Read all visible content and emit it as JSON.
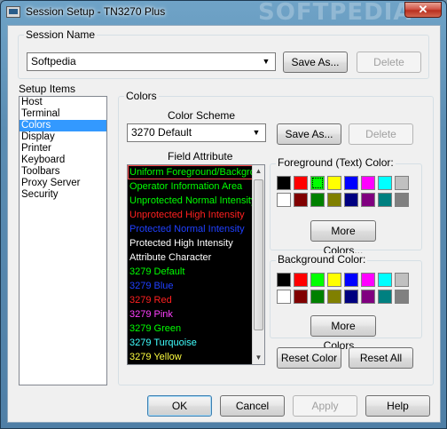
{
  "window": {
    "title": "Session Setup - TN3270 Plus",
    "close_glyph": "✕",
    "watermark": "SOFTPEDIA"
  },
  "session": {
    "label": "Session Name",
    "value": "Softpedia",
    "save_as": "Save As...",
    "delete": "Delete"
  },
  "setup_items": {
    "label": "Setup Items",
    "items": [
      "Host",
      "Terminal",
      "Colors",
      "Display",
      "Printer",
      "Keyboard",
      "Toolbars",
      "Proxy Server",
      "Security"
    ],
    "selected": "Colors"
  },
  "colors": {
    "label": "Colors",
    "scheme_label": "Color Scheme",
    "scheme_value": "3270 Default",
    "save_as": "Save As...",
    "delete": "Delete",
    "field_attr_label": "Field Attribute",
    "attributes": [
      {
        "label": "Uniform Foreground/Background",
        "color": "#00ff00"
      },
      {
        "label": "Operator Information Area",
        "color": "#00ff00"
      },
      {
        "label": "Unprotected Normal Intensity",
        "color": "#00ff00"
      },
      {
        "label": "Unprotected High Intensity",
        "color": "#ff2020"
      },
      {
        "label": "Protected Normal Intensity",
        "color": "#2040ff"
      },
      {
        "label": "Protected High Intensity",
        "color": "#ffffff"
      },
      {
        "label": "Attribute Character",
        "color": "#ffffff"
      },
      {
        "label": "3279 Default",
        "color": "#00ff00"
      },
      {
        "label": "3279 Blue",
        "color": "#2040ff"
      },
      {
        "label": "3279 Red",
        "color": "#ff2020"
      },
      {
        "label": "3279 Pink",
        "color": "#ff40ff"
      },
      {
        "label": "3279 Green",
        "color": "#00ff00"
      },
      {
        "label": "3279 Turquoise",
        "color": "#40ffff"
      },
      {
        "label": "3279 Yellow",
        "color": "#ffff40"
      }
    ],
    "selected_attribute": "Uniform Foreground/Background",
    "foreground_label": "Foreground (Text) Color:",
    "background_label": "Background Color:",
    "more_colors": "More Colors...",
    "palette": [
      "#000000",
      "#ff0000",
      "#00ff00",
      "#ffff00",
      "#0000ff",
      "#ff00ff",
      "#00ffff",
      "#c0c0c0",
      "#ffffff",
      "#800000",
      "#008000",
      "#808000",
      "#000080",
      "#800080",
      "#008080",
      "#808080"
    ],
    "foreground_selected": "#00ff00",
    "reset_color": "Reset Color",
    "reset_all": "Reset All"
  },
  "footer": {
    "ok": "OK",
    "cancel": "Cancel",
    "apply": "Apply",
    "help": "Help"
  }
}
